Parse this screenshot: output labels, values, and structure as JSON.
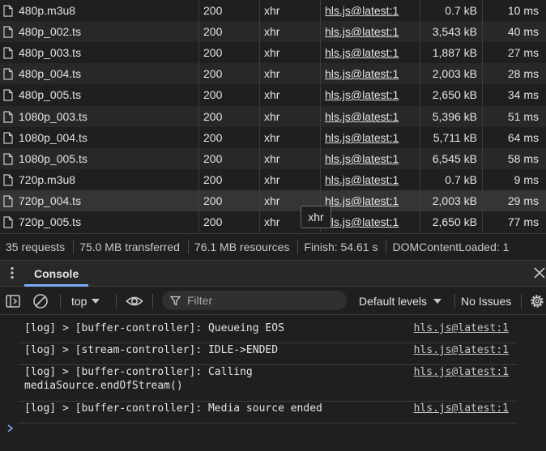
{
  "network": {
    "rows": [
      {
        "name": "480p.m3u8",
        "status": "200",
        "type": "xhr",
        "initiator": "hls.js@latest:1",
        "size": "0.7 kB",
        "time": "10 ms"
      },
      {
        "name": "480p_002.ts",
        "status": "200",
        "type": "xhr",
        "initiator": "hls.js@latest:1",
        "size": "3,543 kB",
        "time": "40 ms"
      },
      {
        "name": "480p_003.ts",
        "status": "200",
        "type": "xhr",
        "initiator": "hls.js@latest:1",
        "size": "1,887 kB",
        "time": "27 ms"
      },
      {
        "name": "480p_004.ts",
        "status": "200",
        "type": "xhr",
        "initiator": "hls.js@latest:1",
        "size": "2,003 kB",
        "time": "28 ms"
      },
      {
        "name": "480p_005.ts",
        "status": "200",
        "type": "xhr",
        "initiator": "hls.js@latest:1",
        "size": "2,650 kB",
        "time": "34 ms"
      },
      {
        "name": "1080p_003.ts",
        "status": "200",
        "type": "xhr",
        "initiator": "hls.js@latest:1",
        "size": "5,396 kB",
        "time": "51 ms"
      },
      {
        "name": "1080p_004.ts",
        "status": "200",
        "type": "xhr",
        "initiator": "hls.js@latest:1",
        "size": "5,711 kB",
        "time": "64 ms"
      },
      {
        "name": "1080p_005.ts",
        "status": "200",
        "type": "xhr",
        "initiator": "hls.js@latest:1",
        "size": "6,545 kB",
        "time": "58 ms"
      },
      {
        "name": "720p.m3u8",
        "status": "200",
        "type": "xhr",
        "initiator": "hls.js@latest:1",
        "size": "0.7 kB",
        "time": "9 ms"
      },
      {
        "name": "720p_004.ts",
        "status": "200",
        "type": "xhr",
        "initiator": "hls.js@latest:1",
        "size": "2,003 kB",
        "time": "29 ms"
      },
      {
        "name": "720p_005.ts",
        "status": "200",
        "type": "xhr",
        "initiator": "hls.js@latest:1",
        "size": "2,650 kB",
        "time": "77 ms"
      }
    ],
    "tooltip": "xhr"
  },
  "summary": {
    "requests": "35 requests",
    "transferred": "75.0 MB transferred",
    "resources": "76.1 MB resources",
    "finish": "Finish: 54.61 s",
    "dom_content_loaded": "DOMContentLoaded: 1"
  },
  "drawer": {
    "tab_console": "Console"
  },
  "toolbar": {
    "context": "top",
    "filter_placeholder": "Filter",
    "levels": "Default levels",
    "issues": "No Issues"
  },
  "console": {
    "messages": [
      {
        "text": "[log] > [buffer-controller]: Queueing EOS",
        "source": "hls.js@latest:1"
      },
      {
        "text": "[log] > [stream-controller]: IDLE->ENDED",
        "source": "hls.js@latest:1"
      },
      {
        "text": "[log] > [buffer-controller]: Calling\nmediaSource.endOfStream()",
        "source": "hls.js@latest:1"
      },
      {
        "text": "[log] > [buffer-controller]: Media source ended",
        "source": "hls.js@latest:1"
      }
    ]
  },
  "colors": {
    "background": "#1f1f1f",
    "accent": "#7cacf8"
  }
}
